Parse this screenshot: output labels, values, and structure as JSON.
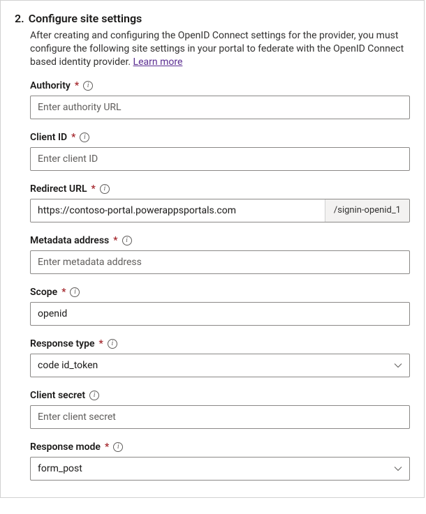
{
  "step": {
    "number": "2.",
    "title": "Configure site settings",
    "intro_text": "After creating and configuring the OpenID Connect settings for the provider, you must configure the following site settings in your portal to federate with the OpenID Connect based identity provider. ",
    "learn_more": "Learn more"
  },
  "fields": {
    "authority": {
      "label": "Authority",
      "required": "*",
      "placeholder": "Enter authority URL",
      "value": ""
    },
    "client_id": {
      "label": "Client ID",
      "required": "*",
      "placeholder": "Enter client ID",
      "value": ""
    },
    "redirect_url": {
      "label": "Redirect URL",
      "required": "*",
      "value": "https://contoso-portal.powerappsportals.com",
      "suffix": "/signin-openid_1"
    },
    "metadata_address": {
      "label": "Metadata address",
      "required": "*",
      "placeholder": "Enter metadata address",
      "value": ""
    },
    "scope": {
      "label": "Scope",
      "required": "*",
      "value": "openid"
    },
    "response_type": {
      "label": "Response type",
      "required": "*",
      "value": "code id_token"
    },
    "client_secret": {
      "label": "Client secret",
      "placeholder": "Enter client secret",
      "value": ""
    },
    "response_mode": {
      "label": "Response mode",
      "required": "*",
      "value": "form_post"
    }
  }
}
